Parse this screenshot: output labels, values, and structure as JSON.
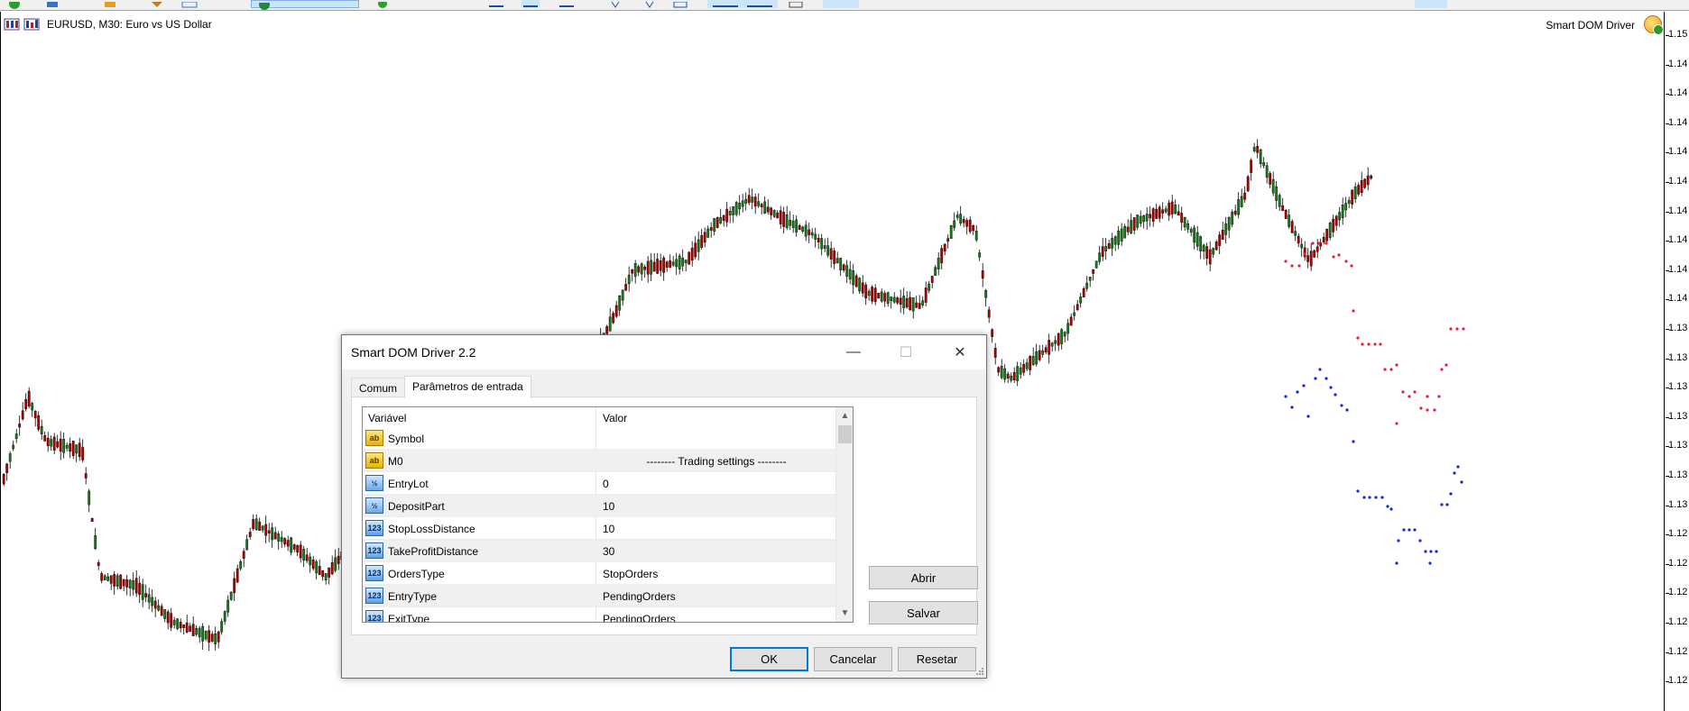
{
  "chart": {
    "title": "EURUSD, M30:  Euro vs US Dollar",
    "ea_name": "Smart DOM Driver",
    "price_labels": [
      "1.15",
      "1.14",
      "1.14",
      "1.14",
      "1.14",
      "1.14",
      "1.14",
      "1.14",
      "1.14",
      "1.14",
      "1.13",
      "1.13",
      "1.13",
      "1.13",
      "1.13",
      "1.13",
      "1.13",
      "1.12",
      "1.12",
      "1.12",
      "1.12",
      "1.12",
      "1.12"
    ],
    "colors": {
      "bull": "#1a7a1a",
      "bear": "#b00000",
      "dots_red": "#e8203a",
      "dots_blue": "#1028e0"
    }
  },
  "dialog": {
    "title": "Smart DOM Driver 2.2",
    "window_controls": {
      "minimize": "—",
      "maximize": "☐",
      "close": "✕"
    },
    "tabs": [
      {
        "label": "Comum",
        "active": false
      },
      {
        "label": "Parâmetros de entrada",
        "active": true
      }
    ],
    "grid": {
      "col_variable": "Variável",
      "col_value": "Valor",
      "rows": [
        {
          "icon": "ab",
          "icon_text": "ab",
          "name": "Symbol",
          "value": ""
        },
        {
          "icon": "ab",
          "icon_text": "ab",
          "name": "M0",
          "value": "-------- Trading settings --------"
        },
        {
          "icon": "half",
          "icon_text": "½",
          "name": "EntryLot",
          "value": "0"
        },
        {
          "icon": "half",
          "icon_text": "½",
          "name": "DepositPart",
          "value": "10"
        },
        {
          "icon": "num",
          "icon_text": "123",
          "name": "StopLossDistance",
          "value": "10"
        },
        {
          "icon": "num",
          "icon_text": "123",
          "name": "TakeProfitDistance",
          "value": "30"
        },
        {
          "icon": "num",
          "icon_text": "123",
          "name": "OrdersType",
          "value": "StopOrders"
        },
        {
          "icon": "num",
          "icon_text": "123",
          "name": "EntryType",
          "value": "PendingOrders"
        },
        {
          "icon": "num",
          "icon_text": "123",
          "name": "ExitType",
          "value": "PendingOrders"
        }
      ]
    },
    "buttons": {
      "open": "Abrir",
      "save": "Salvar",
      "ok": "OK",
      "cancel": "Cancelar",
      "reset": "Resetar"
    }
  }
}
